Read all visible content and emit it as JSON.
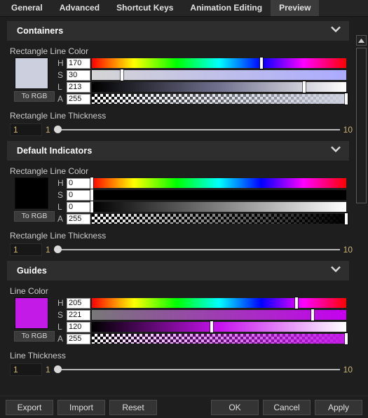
{
  "tabs": [
    {
      "label": "General",
      "active": false
    },
    {
      "label": "Advanced",
      "active": false
    },
    {
      "label": "Shortcut Keys",
      "active": false
    },
    {
      "label": "Animation Editing",
      "active": false
    },
    {
      "label": "Preview",
      "active": true
    }
  ],
  "sections": [
    {
      "title": "Containers",
      "chevron_icon": "chevron-down-icon",
      "color_field_label": "Rectangle Line Color",
      "swatch_color": "#ccd0de",
      "to_rgb_label": "To RGB",
      "channels": [
        {
          "letter": "H",
          "value": "170",
          "max": 255
        },
        {
          "letter": "S",
          "value": "30",
          "max": 255
        },
        {
          "letter": "L",
          "value": "213",
          "max": 255
        },
        {
          "letter": "A",
          "value": "255",
          "max": 255
        }
      ],
      "thickness_label": "Rectangle Line Thickness",
      "thickness_value": "1",
      "thickness_min": "1",
      "thickness_max": "10"
    },
    {
      "title": "Default Indicators",
      "chevron_icon": "chevron-down-icon",
      "color_field_label": "Rectangle Line Color",
      "swatch_color": "#000000",
      "to_rgb_label": "To RGB",
      "channels": [
        {
          "letter": "H",
          "value": "0",
          "max": 255
        },
        {
          "letter": "S",
          "value": "0",
          "max": 255
        },
        {
          "letter": "L",
          "value": "0",
          "max": 255
        },
        {
          "letter": "A",
          "value": "255",
          "max": 255
        }
      ],
      "thickness_label": "Rectangle Line Thickness",
      "thickness_value": "1",
      "thickness_min": "1",
      "thickness_max": "10"
    },
    {
      "title": "Guides",
      "chevron_icon": "chevron-down-icon",
      "color_field_label": "Line Color",
      "swatch_color": "#c41ae8",
      "to_rgb_label": "To RGB",
      "channels": [
        {
          "letter": "H",
          "value": "205",
          "max": 255
        },
        {
          "letter": "S",
          "value": "221",
          "max": 255
        },
        {
          "letter": "L",
          "value": "120",
          "max": 255
        },
        {
          "letter": "A",
          "value": "255",
          "max": 255
        }
      ],
      "thickness_label": "Line Thickness",
      "thickness_value": "1",
      "thickness_min": "1",
      "thickness_max": "10"
    }
  ],
  "scrollbar": {
    "up_icon": "scroll-up-arrow-icon",
    "down_icon": "scroll-down-arrow-icon"
  },
  "buttons": {
    "left": [
      {
        "label": "Export",
        "name": "export-button"
      },
      {
        "label": "Import",
        "name": "import-button"
      },
      {
        "label": "Reset",
        "name": "reset-button"
      }
    ],
    "right": [
      {
        "label": "OK",
        "name": "ok-button"
      },
      {
        "label": "Cancel",
        "name": "cancel-button"
      },
      {
        "label": "Apply",
        "name": "apply-button"
      }
    ]
  },
  "colors": {
    "background": "#1e1e1e",
    "section_header": "#2e2e2e",
    "active_tab": "#3b3b3b",
    "accent_number": "#cdb378"
  }
}
